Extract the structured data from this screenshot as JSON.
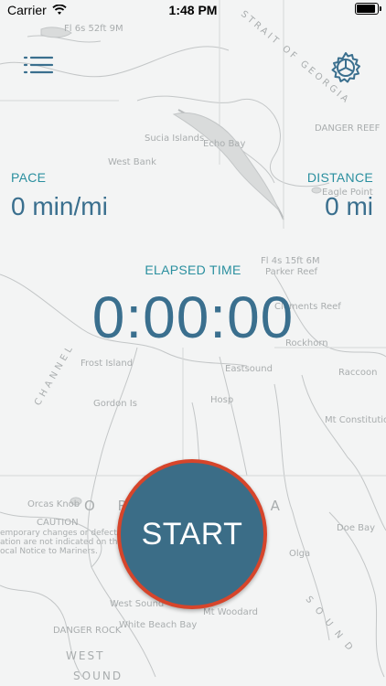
{
  "status_bar": {
    "carrier": "Carrier",
    "time": "1:48 PM",
    "wifi_icon": "wifi-icon",
    "battery_icon": "battery-icon"
  },
  "header": {
    "menu_icon": "list-menu-icon",
    "settings_icon": "gear-icon"
  },
  "stats": {
    "pace_label": "PACE",
    "pace_value": "0 min/mi",
    "distance_label": "DISTANCE",
    "distance_value": "0 mi",
    "elapsed_label": "ELAPSED TIME",
    "elapsed_value": "0:00:00"
  },
  "start_button": {
    "label": "START"
  },
  "map_labels": {
    "strait": "STRAIT OF GEORGIA",
    "sucia": "Sucia Islands",
    "west_bank": "West Bank",
    "echo_bay": "Echo Bay",
    "danger_reef": "DANGER REEF",
    "eagle_point": "Eagle Point",
    "parker_reef": "Parker Reef",
    "eastsound": "Eastsound",
    "rockhorn": "Rockhorn",
    "frost_island": "Frost Island",
    "orcas_island": "O R  C         I S L A",
    "caution": "CAUTION",
    "caution_text_1": "emporary changes or defects in aids to",
    "caution_text_2": "ation are not indicated on this chart. See",
    "caution_text_3": "ocal Notice to Mariners.",
    "west_sound": "West Sound",
    "white_beach_bay": "White Beach Bay",
    "mt_woodard": "Mt Woodard",
    "danger_rock": "DANGER ROCK",
    "west": "WEST",
    "sound": "SOUND",
    "channel": "CHANNEL",
    "doe_bay": "Doe Bay",
    "mt_constitution": "Mt Constitution",
    "olga": "Olga",
    "raccoon": "Raccoon",
    "clements_reef": "Clements Reef",
    "skipjack": "Fl 6s 52ft 9M",
    "flashing": "Fl 4s 15ft 6M",
    "sound_right": "S O U N D",
    "gordon": "Gordon Is",
    "hospital": "Hosp",
    "orcas_knob": "Orcas Knob"
  }
}
